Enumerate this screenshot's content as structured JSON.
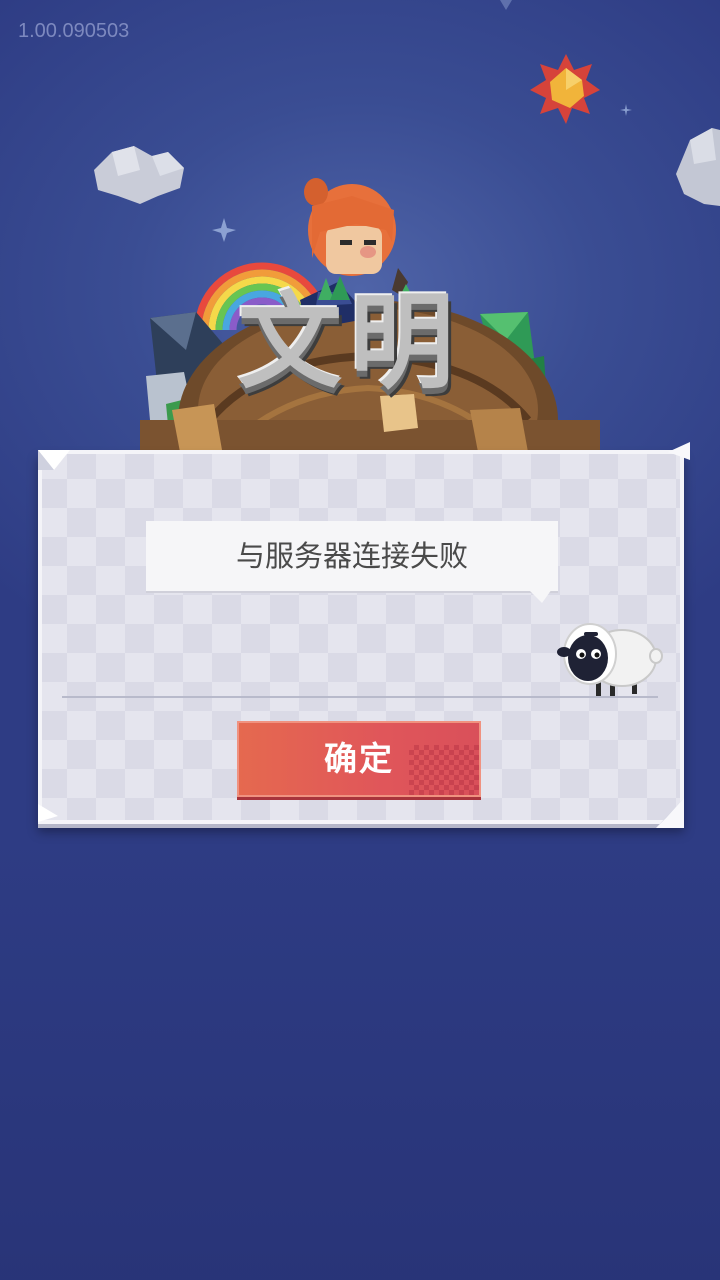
{
  "app": {
    "version": "1.00.090503",
    "logo_text": [
      "文",
      "明"
    ]
  },
  "dialog": {
    "message": "与服务器连接失败",
    "confirm_label": "确定"
  },
  "icons": {
    "mascot": "sheep-icon",
    "sun": "sun-icon",
    "cloud": "cloud-icon",
    "character": "character-illustration"
  },
  "colors": {
    "background": "#3a4d93",
    "button": "#e0565a",
    "dialog_paper": "#e5e5ee",
    "text": "#4a4a4a"
  }
}
